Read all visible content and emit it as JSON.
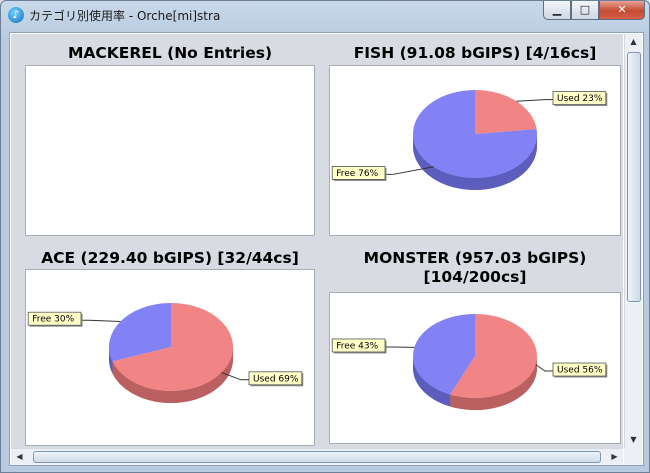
{
  "window": {
    "title": "カテゴリ別使用率 - Orche[mi]stra",
    "app_icon": "note-icon",
    "min_glyph": "▁",
    "max_glyph": "□",
    "close_glyph": "✕"
  },
  "panels": [
    {
      "title": "MACKEREL (No Entries)"
    },
    {
      "title": "FISH (91.08 bGIPS) [4/16cs]"
    },
    {
      "title": "ACE (229.40 bGIPS) [32/44cs]"
    },
    {
      "title_line1": "MONSTER (957.03 bGIPS)",
      "title_line2": "[104/200cs]"
    }
  ],
  "chart_data": [
    {
      "type": "pie",
      "title": "MACKEREL (No Entries)",
      "categories": [],
      "values": []
    },
    {
      "type": "pie",
      "title": "FISH (91.08 bGIPS) [4/16cs]",
      "categories": [
        "Used",
        "Free"
      ],
      "values": [
        23,
        76
      ],
      "labels": [
        "Used 23%",
        "Free 76%"
      ],
      "colors": [
        "#f07b7b",
        "#7777f4"
      ]
    },
    {
      "type": "pie",
      "title": "ACE (229.40 bGIPS) [32/44cs]",
      "categories": [
        "Used",
        "Free"
      ],
      "values": [
        69,
        30
      ],
      "labels": [
        "Used 69%",
        "Free 30%"
      ],
      "colors": [
        "#f07b7b",
        "#7777f4"
      ]
    },
    {
      "type": "pie",
      "title": "MONSTER (957.03 bGIPS) [104/200cs]",
      "categories": [
        "Used",
        "Free"
      ],
      "values": [
        56,
        43
      ],
      "labels": [
        "Used 56%",
        "Free 43%"
      ],
      "colors": [
        "#f07b7b",
        "#7777f4"
      ]
    }
  ]
}
